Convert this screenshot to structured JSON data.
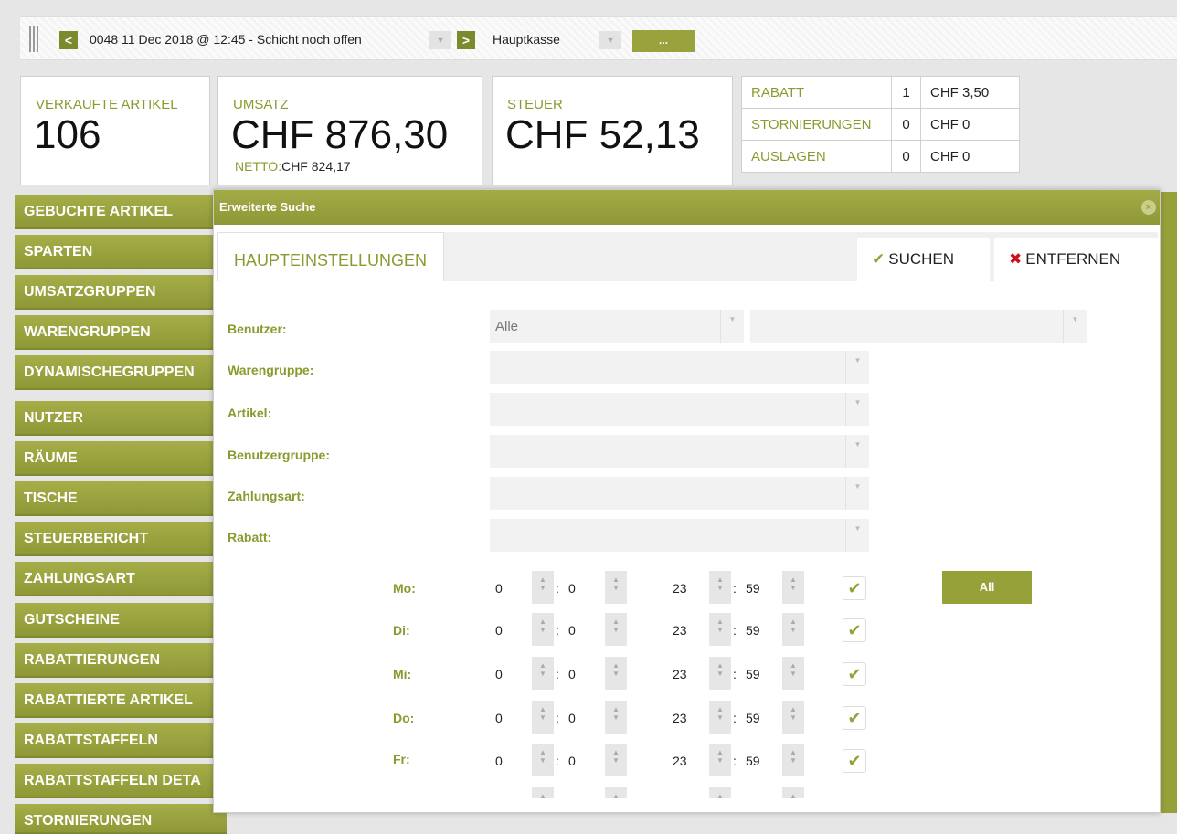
{
  "toolbar": {
    "prev": "<",
    "shift": "0048 11 Dec 2018 @ 12:45 - Schicht noch offen",
    "next": ">",
    "register": "Hauptkasse",
    "more": "..."
  },
  "stats": {
    "sold_label": "VERKAUFTE ARTIKEL",
    "sold_value": "106",
    "revenue_label": "UMSATZ",
    "revenue_value": "CHF 876,30",
    "net_label": "NETTO:",
    "net_value": "CHF 824,17",
    "tax_label": "STEUER",
    "tax_value": "CHF 52,13"
  },
  "mini_table": [
    {
      "label": "RABATT",
      "count": "1",
      "amount": "CHF 3,50"
    },
    {
      "label": "STORNIERUNGEN",
      "count": "0",
      "amount": "CHF 0"
    },
    {
      "label": "AUSLAGEN",
      "count": "0",
      "amount": "CHF 0"
    }
  ],
  "sidebar": [
    "GEBUCHTE ARTIKEL",
    "SPARTEN",
    "UMSATZGRUPPEN",
    "WARENGRUPPEN",
    "DYNAMISCHEGRUPPEN",
    "NUTZER",
    "RÄUME",
    "TISCHE",
    "STEUERBERICHT",
    "ZAHLUNGSART",
    "GUTSCHEINE",
    "RABATTIERUNGEN",
    "RABATTIERTE ARTIKEL",
    "RABATTSTAFFELN",
    "RABATTSTAFFELN DETA",
    "STORNIERUNGEN"
  ],
  "modal": {
    "title": "Erweiterte Suche",
    "tab": "HAUPTEINSTELLUNGEN",
    "search": "SUCHEN",
    "remove": "ENTFERNEN",
    "fields": {
      "user": "Benutzer:",
      "user_value": "Alle",
      "group": "Warengruppe:",
      "article": "Artikel:",
      "usergroup": "Benutzergruppe:",
      "payment": "Zahlungsart:",
      "discount": "Rabatt:"
    },
    "days": [
      {
        "label": "Mo:",
        "from_h": "0",
        "from_m": "0",
        "to_h": "23",
        "to_m": "59"
      },
      {
        "label": "Di:",
        "from_h": "0",
        "from_m": "0",
        "to_h": "23",
        "to_m": "59"
      },
      {
        "label": "Mi:",
        "from_h": "0",
        "from_m": "0",
        "to_h": "23",
        "to_m": "59"
      },
      {
        "label": "Do:",
        "from_h": "0",
        "from_m": "0",
        "to_h": "23",
        "to_m": "59"
      },
      {
        "label": "Fr:",
        "from_h": "0",
        "from_m": "0",
        "to_h": "23",
        "to_m": "59"
      }
    ],
    "all": "All"
  }
}
